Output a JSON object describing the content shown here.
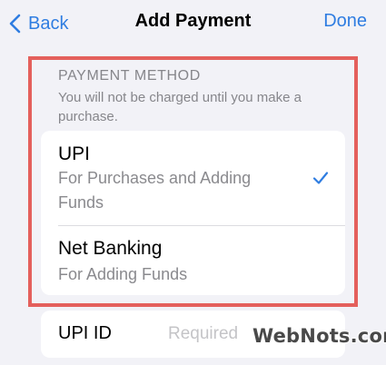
{
  "nav": {
    "back_label": "Back",
    "title": "Add Payment",
    "done_label": "Done"
  },
  "payment_method": {
    "header": "PAYMENT METHOD",
    "note": "You will not be charged until you make a purchase.",
    "options": [
      {
        "title": "UPI",
        "subtitle": "For Purchases and Adding Funds",
        "selected": true
      },
      {
        "title": "Net Banking",
        "subtitle": "For Adding Funds",
        "selected": false
      }
    ]
  },
  "upi_id": {
    "label": "UPI ID",
    "placeholder": "Required",
    "value": ""
  },
  "watermark": {
    "text": "WebNots.com"
  },
  "colors": {
    "accent": "#2f7de1",
    "highlight_border": "#e4605c",
    "background": "#f2f2f7"
  }
}
